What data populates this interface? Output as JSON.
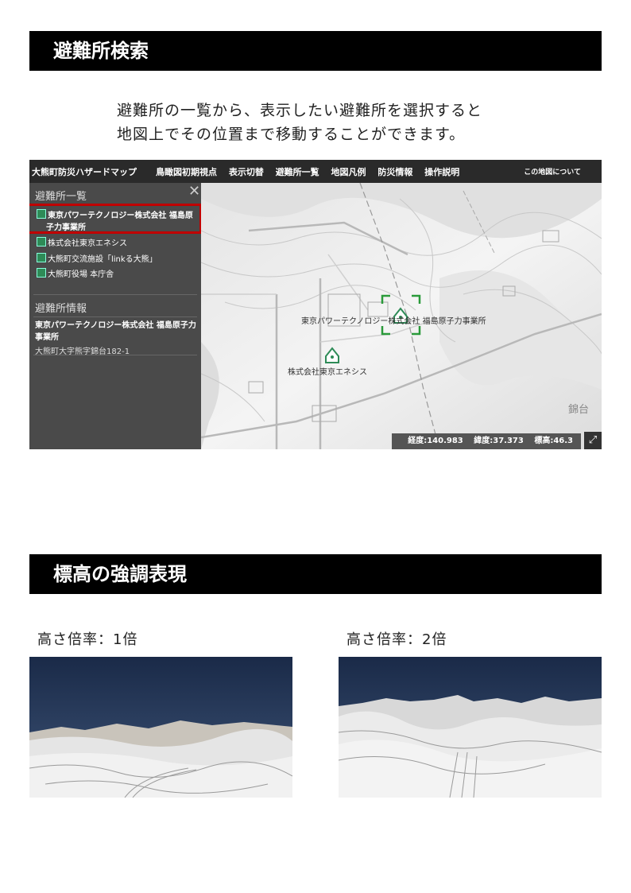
{
  "section1": {
    "heading": "避難所検索",
    "intro_line1": "避難所の一覧から、表示したい避難所を選択すると",
    "intro_line2": "地図上でその位置まで移動することができます。"
  },
  "app": {
    "title": "大熊町防災ハザードマップ",
    "nav": [
      "鳥瞰図初期視点",
      "表示切替",
      "避難所一覧",
      "地図凡例",
      "防災情報",
      "操作説明"
    ],
    "about": "この地図について",
    "panel": {
      "list_heading": "避難所一覧",
      "close_icon": "close-icon",
      "items": [
        "東京パワーテクノロジー株式会社 福島原",
        "子力事業所",
        "株式会社東京エネシス",
        "大熊町交流施設「linkる大熊」",
        "大熊町役場 本庁舎"
      ],
      "info_heading": "避難所情報",
      "info_name": "東京パワーテクノロジー株式会社 福島原子力事業所",
      "info_address": "大熊町大字熊字錦台182-1"
    },
    "map": {
      "label_main": "東京パワーテクノロジー株式会社 福島原子力事業所",
      "label_second": "株式会社東京エネシス",
      "place_label": "錦台",
      "longitude": "経度:140.983",
      "latitude": "緯度:37.373",
      "elevation": "標高:46.3",
      "fullscreen_icon": "expand-icon"
    },
    "colors": {
      "header": "#2a2a2a",
      "panel": "#4a4a4a",
      "selection": "#c00000",
      "marker": "#2e8b57"
    }
  },
  "section2": {
    "heading": "標高の強調表現",
    "label_1x": "高さ倍率：1倍",
    "label_2x": "高さ倍率：2倍"
  }
}
